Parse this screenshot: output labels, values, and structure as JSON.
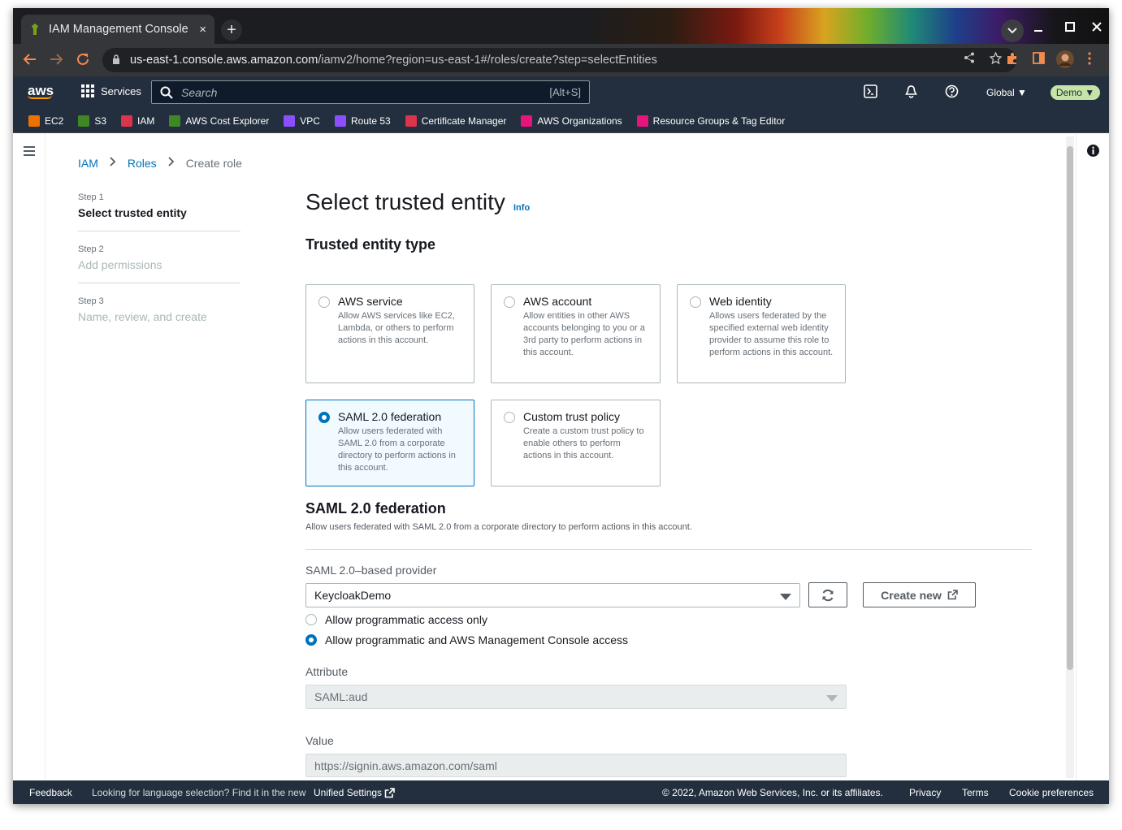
{
  "browser": {
    "tab_title": "IAM Management Console",
    "tab_close": "×",
    "new_tab": "+",
    "url_host": "us-east-1.console.aws.amazon.com",
    "url_path": "/iamv2/home?region=us-east-1#/roles/create?step=selectEntities"
  },
  "aws_nav": {
    "logo": "aws",
    "services_label": "Services",
    "search_placeholder": "Search",
    "search_shortcut": "[Alt+S]",
    "region": "Global ▼",
    "account": "Demo ▼"
  },
  "favorites": [
    {
      "label": "EC2",
      "color": "#ed7100"
    },
    {
      "label": "S3",
      "color": "#3f8624"
    },
    {
      "label": "IAM",
      "color": "#dd344c"
    },
    {
      "label": "AWS Cost Explorer",
      "color": "#3f8624"
    },
    {
      "label": "VPC",
      "color": "#8c4fff"
    },
    {
      "label": "Route 53",
      "color": "#8c4fff"
    },
    {
      "label": "Certificate Manager",
      "color": "#dd344c"
    },
    {
      "label": "AWS Organizations",
      "color": "#e7157b"
    },
    {
      "label": "Resource Groups & Tag Editor",
      "color": "#e7157b"
    }
  ],
  "breadcrumb": {
    "iam": "IAM",
    "roles": "Roles",
    "current": "Create role"
  },
  "steps": [
    {
      "num": "Step 1",
      "title": "Select trusted entity"
    },
    {
      "num": "Step 2",
      "title": "Add permissions"
    },
    {
      "num": "Step 3",
      "title": "Name, review, and create"
    }
  ],
  "page": {
    "title": "Select trusted entity",
    "info": "Info",
    "entity_type_heading": "Trusted entity type"
  },
  "entity_cards": [
    {
      "title": "AWS service",
      "desc": "Allow AWS services like EC2, Lambda, or others to perform actions in this account."
    },
    {
      "title": "AWS account",
      "desc": "Allow entities in other AWS accounts belonging to you or a 3rd party to perform actions in this account."
    },
    {
      "title": "Web identity",
      "desc": "Allows users federated by the specified external web identity provider to assume this role to perform actions in this account."
    },
    {
      "title": "SAML 2.0 federation",
      "desc": "Allow users federated with SAML 2.0 from a corporate directory to perform actions in this account."
    },
    {
      "title": "Custom trust policy",
      "desc": "Create a custom trust policy to enable others to perform actions in this account."
    }
  ],
  "saml": {
    "heading": "SAML 2.0 federation",
    "description": "Allow users federated with SAML 2.0 from a corporate directory to perform actions in this account.",
    "provider_label": "SAML 2.0–based provider",
    "provider_value": "KeycloakDemo",
    "create_new": "Create new",
    "option_programmatic": "Allow programmatic access only",
    "option_console": "Allow programmatic and AWS Management Console access",
    "attribute_label": "Attribute",
    "attribute_value": "SAML:aud",
    "value_label": "Value",
    "value_value": "https://signin.aws.amazon.com/saml"
  },
  "footer": {
    "feedback": "Feedback",
    "language_text": "Looking for language selection? Find it in the new",
    "unified_settings": "Unified Settings",
    "copyright": "© 2022, Amazon Web Services, Inc. or its affiliates.",
    "privacy": "Privacy",
    "terms": "Terms",
    "cookies": "Cookie preferences"
  }
}
